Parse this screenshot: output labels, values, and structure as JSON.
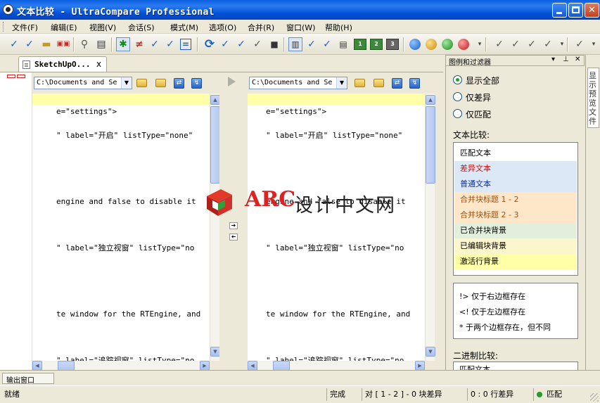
{
  "window": {
    "title": "文本比较 - UltraCompare Professional",
    "minimize_glyph": "_",
    "close_glyph": "✕"
  },
  "menu": [
    "文件(F)",
    "编辑(E)",
    "视图(V)",
    "会话(S)",
    "模式(M)",
    "选项(O)",
    "合并(R)",
    "窗口(W)",
    "帮助(H)"
  ],
  "document_tab": {
    "label": "SketchUpO...",
    "close": "x"
  },
  "left_pane": {
    "path": "C:\\Documents and Se",
    "lines": [
      "e=\"settings\">",
      "\" label=\"开启\" listType=\"none\"",
      " engine and false to disable it",
      "\" label=\"独立视窗\" listType=\"no",
      "te window for the RTEngine, and",
      "\" label=\"追踪视窗\" listType=\"no"
    ]
  },
  "right_pane": {
    "path": "C:\\Documents and Se",
    "lines": [
      "e=\"settings\">",
      "\" label=\"开启\" listType=\"none\"",
      " engine and false to disable it",
      "\" label=\"独立视窗\" listType=\"no",
      "te window for the RTEngine, and",
      "\" label=\"追踪视窗\" listType=\"no"
    ]
  },
  "watermark": {
    "brand": "ARC",
    "text": "设计中文网"
  },
  "filter_panel": {
    "title": "图例和过滤器",
    "radios": [
      {
        "label": "显示全部",
        "selected": true
      },
      {
        "label": "仅差异",
        "selected": false
      },
      {
        "label": "仅匹配",
        "selected": false
      }
    ],
    "text_compare_label": "文本比较:",
    "legend": [
      {
        "label": "匹配文本",
        "bg": "#ffffff",
        "fg": "#000000"
      },
      {
        "label": "差异文本",
        "bg": "#dce8f6",
        "fg": "#d01010"
      },
      {
        "label": "普通文本",
        "bg": "#dce8f6",
        "fg": "#1030a0"
      },
      {
        "label": "合并块标题 1 - 2",
        "bg": "#fde7c8",
        "fg": "#a05010"
      },
      {
        "label": "合并块标题 2 - 3",
        "bg": "#fde7c8",
        "fg": "#a05010"
      },
      {
        "label": "已合并块背景",
        "bg": "#e2efdc",
        "fg": "#000000"
      },
      {
        "label": "已编辑块背景",
        "bg": "#fbf6cc",
        "fg": "#000000"
      },
      {
        "label": "激活行背景",
        "bg": "#ffffa8",
        "fg": "#000000"
      }
    ],
    "notes": [
      "!> 仅于右边框存在",
      "<! 仅于左边框存在",
      "* 于两个边框存在，但不同"
    ],
    "binary_label": "二进制比较:",
    "binary_partial": "匹配文本"
  },
  "side_tab": {
    "label": "显示预览文件"
  },
  "output_tab": {
    "label": "输出窗口"
  },
  "status": {
    "ready": "就绪",
    "done": "完成",
    "pair_diff": "对 [ 1 - 2 ] - 0 块差异",
    "line_diff": "0 : 0 行差异",
    "match": "匹配"
  },
  "colors": {
    "title_blue": "#0a5fe0",
    "active_line": "#ffffa8",
    "watermark_red": "#dd2222"
  }
}
